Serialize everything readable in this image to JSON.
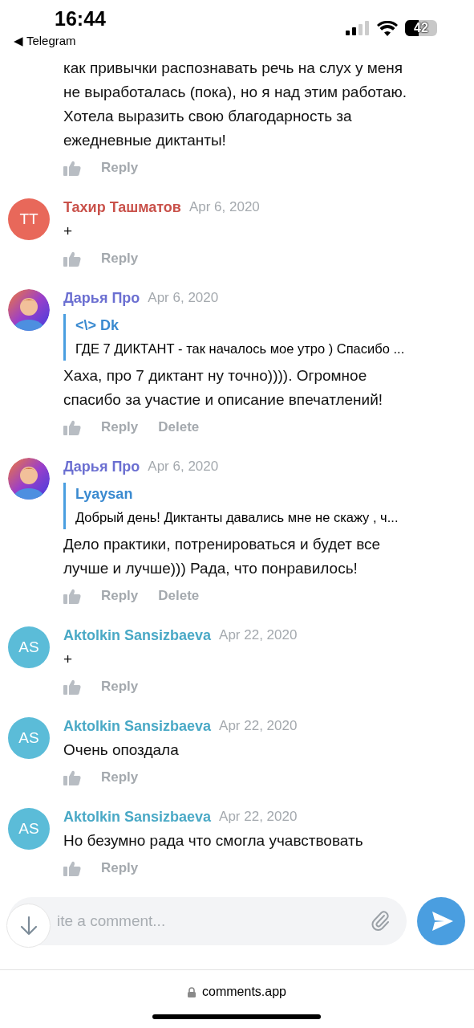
{
  "status_bar": {
    "time": "16:44",
    "back_arrow": "◀",
    "back_app": "Telegram",
    "battery": "42"
  },
  "comments": [
    {
      "body": "как привычки распознавать речь на слух у меня\nне выработалась (пока), но я над этим работаю.\nХотела выразить свою благодарность за\nежедневные диктанты!",
      "actions": [
        "Reply"
      ]
    },
    {
      "author": "Тахир Ташматов",
      "color": "#c9514a",
      "avatar": {
        "kind": "initials",
        "initials": "TT",
        "color": "#e8685a"
      },
      "date": "Apr 6, 2020",
      "body": "+",
      "actions": [
        "Reply"
      ]
    },
    {
      "author": "Дарья Про",
      "color": "#6b6fd1",
      "date": "Apr 6, 2020",
      "quote": {
        "author": "<\\> Dk",
        "text": "ГДЕ 7 ДИКТАНТ - так началось мое утро ) Спасибо ..."
      },
      "body": "Хаха, про 7 диктант ну точно)))). Огромное\nспасибо за участие и описание впечатлений!",
      "actions": [
        "Reply",
        "Delete"
      ]
    },
    {
      "author": "Дарья Про",
      "color": "#6b6fd1",
      "date": "Apr 6, 2020",
      "quote": {
        "author": "Lyaysan",
        "text": "Добрый день! Диктанты давались мне не скажу , ч..."
      },
      "body": "Дело практики, потренироваться и будет все\nлучше и лучше))) Рада, что понравилось!",
      "actions": [
        "Reply",
        "Delete"
      ]
    },
    {
      "author": "Aktolkin Sansizbaeva",
      "color": "#4aa9c6",
      "avatar": {
        "kind": "initials",
        "initials": "AS",
        "color": "#5bbcd8"
      },
      "date": "Apr 22, 2020",
      "body": "+",
      "actions": [
        "Reply"
      ]
    },
    {
      "author": "Aktolkin Sansizbaeva",
      "color": "#4aa9c6",
      "avatar": {
        "kind": "initials",
        "initials": "AS",
        "color": "#5bbcd8"
      },
      "date": "Apr 22, 2020",
      "body": "Очень опоздала",
      "actions": [
        "Reply"
      ]
    },
    {
      "author": "Aktolkin Sansizbaeva",
      "color": "#4aa9c6",
      "avatar": {
        "kind": "initials",
        "initials": "AS",
        "color": "#5bbcd8"
      },
      "date": "Apr 22, 2020",
      "body": "Но безумно рада что смогла учавствовать",
      "actions": [
        "Reply"
      ]
    }
  ],
  "composer": {
    "placeholder": "ite a comment..."
  },
  "address_bar": {
    "url": "comments.app"
  }
}
